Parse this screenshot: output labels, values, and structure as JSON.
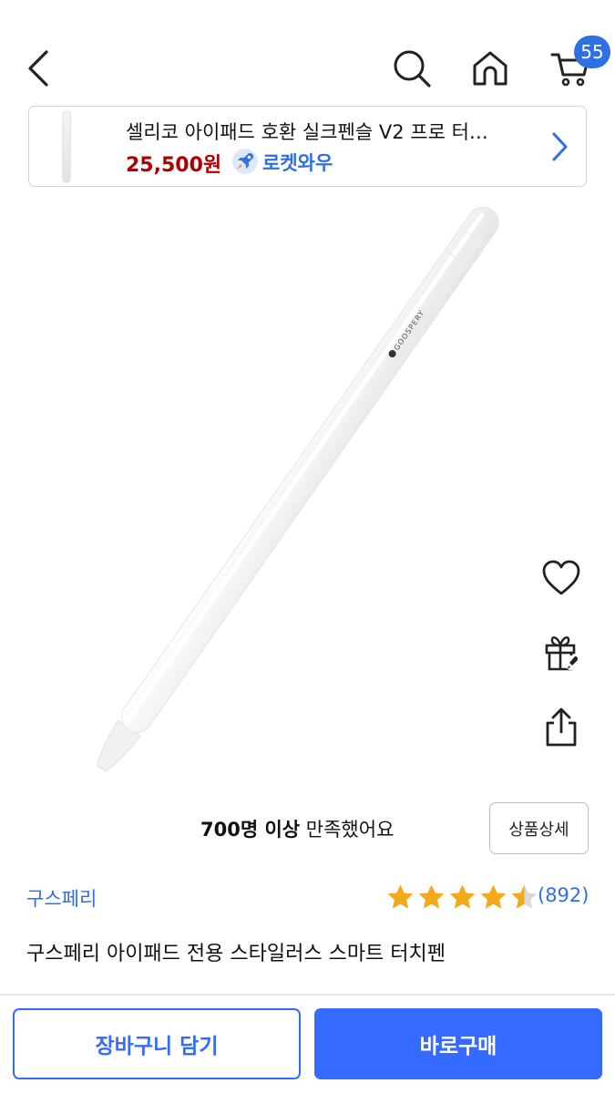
{
  "header": {
    "cart_badge": "55",
    "icons": [
      "chevron-left-icon",
      "search-icon",
      "home-icon",
      "cart-icon"
    ]
  },
  "mini_card": {
    "title": "셀리코 아이패드 호환 실크펜슬 V2 프로 터…",
    "price": "25,500원",
    "rocket_label": "로켓와우",
    "price_color": "#ae0000",
    "rocket_color": "#2f6fe4"
  },
  "product_image": {
    "brand_mark": "GOOSPERY"
  },
  "actions": {
    "icons": [
      "heart-icon",
      "gift-icon",
      "share-icon"
    ]
  },
  "satisfaction": {
    "count": "700명 이상",
    "suffix": " 만족했어요",
    "detail_button": "상품상세"
  },
  "product": {
    "brand": "구스페리",
    "rating": 4.5,
    "rating_max": 5,
    "review_count": "(892)",
    "name": "구스페리 아이패드 전용 스타일러스 스마트 터치펜"
  },
  "bottom_bar": {
    "add_to_cart": "장바구니 담기",
    "buy_now": "바로구매",
    "accent": "#346aff"
  }
}
